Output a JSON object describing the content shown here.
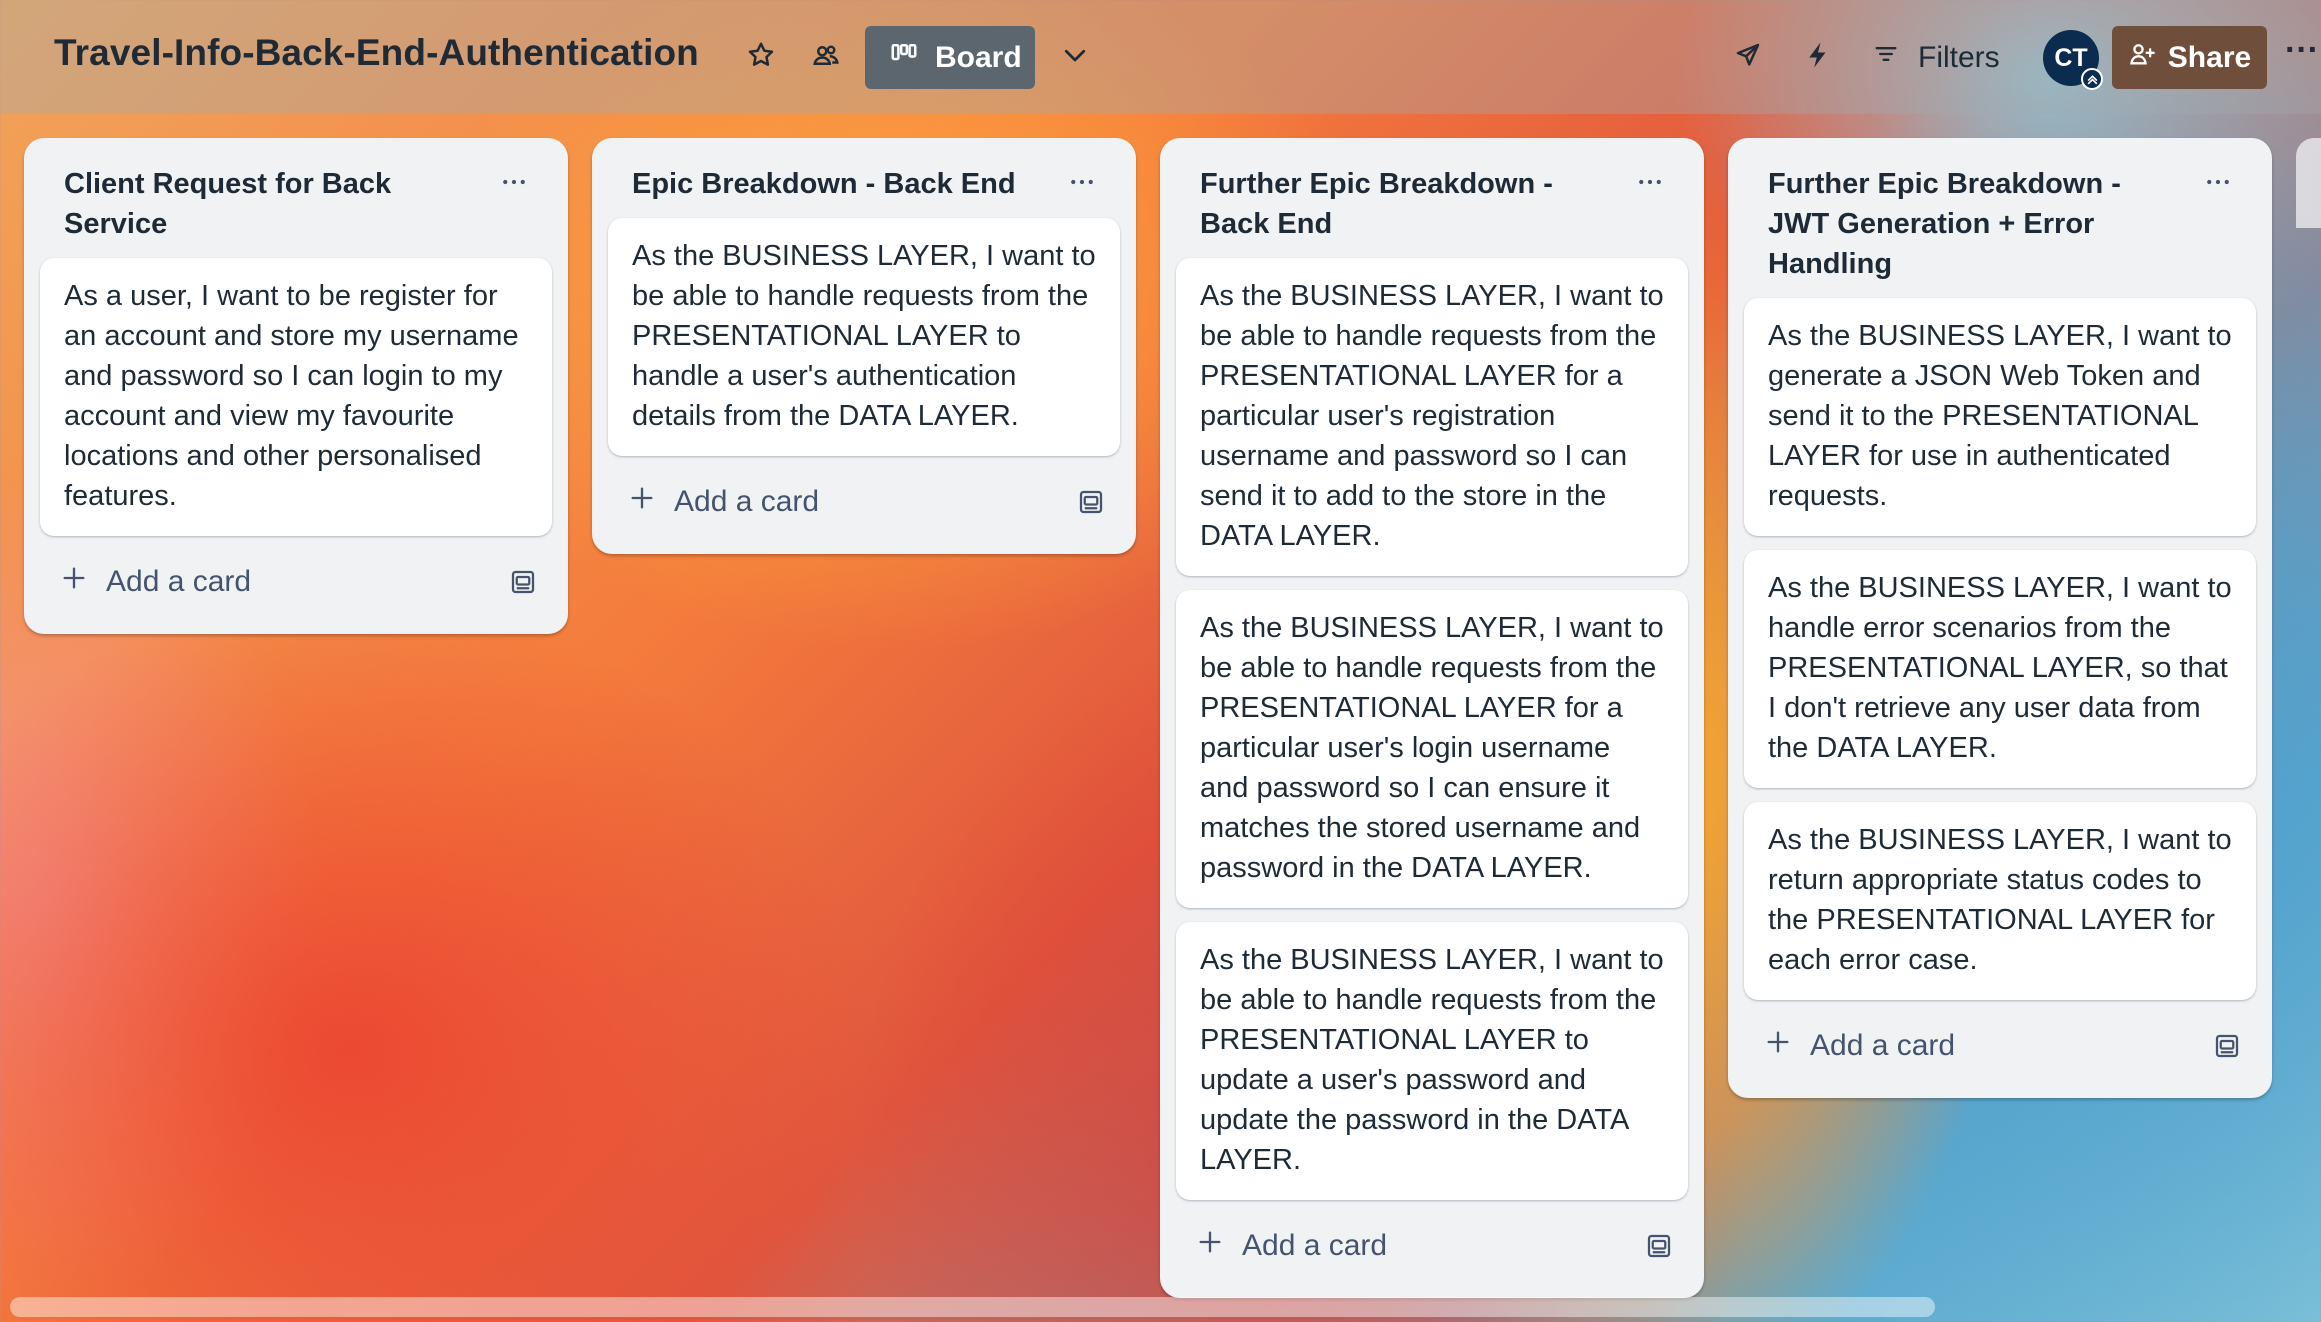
{
  "header": {
    "board_title": "Travel-Info-Back-End-Authentication",
    "view_label": "Board",
    "filters_label": "Filters",
    "avatar_initials": "CT",
    "share_label": "Share",
    "more_label": "···"
  },
  "lists": [
    {
      "title": "Client Request for Back Service",
      "cards": [
        "As a user, I want to be register for an account and store my username and password so I can login to my account and view my favourite locations and other personalised features."
      ],
      "add_card_label": "Add a card"
    },
    {
      "title": "Epic Breakdown - Back End",
      "cards": [
        "As the BUSINESS LAYER, I want to be able to handle requests from the PRESENTATIONAL LAYER to handle a user's authentication details from the DATA LAYER."
      ],
      "add_card_label": "Add a card"
    },
    {
      "title": "Further Epic Breakdown - Back End",
      "cards": [
        "As the BUSINESS LAYER, I want to be able to handle requests from the PRESENTATIONAL LAYER for a particular user's registration username and password so I can send it to add to the store in the DATA LAYER.",
        "As the BUSINESS LAYER, I want to be able to handle requests from the PRESENTATIONAL LAYER for a particular user's login username and password so I can ensure it matches the stored username and password in the DATA LAYER.",
        "As the BUSINESS LAYER, I want to be able to handle requests from the PRESENTATIONAL LAYER to update a user's password and update the password in the DATA LAYER."
      ],
      "add_card_label": "Add a card"
    },
    {
      "title": "Further Epic Breakdown - JWT Generation + Error Handling",
      "cards": [
        "As the BUSINESS LAYER, I want to generate a JSON Web Token and send it to the PRESENTATIONAL LAYER for use in authenticated requests.",
        "As the BUSINESS LAYER, I want to handle error scenarios from the PRESENTATIONAL LAYER, so that I don't retrieve any user data from the DATA LAYER.",
        "As the BUSINESS LAYER, I want to return appropriate status codes to the PRESENTATIONAL LAYER for each error case."
      ],
      "add_card_label": "Add a card"
    }
  ],
  "icons": {
    "star": "star-icon",
    "visibility": "workspace-visible-icon",
    "board": "board-icon",
    "chevron": "chevron-down-icon",
    "power_ups": "rocket-icon",
    "automation": "lightning-icon",
    "filter": "filter-icon",
    "share": "add-member-icon",
    "list_menu": "ellipsis-icon",
    "add": "plus-icon",
    "template": "card-template-icon"
  },
  "colors": {
    "board_button": "#5c666e",
    "share_button": "#6f4e3c",
    "avatar": "#0b2c4e",
    "list_bg": "#f1f2f4",
    "card_bg": "#ffffff",
    "text": "#1f2a37"
  }
}
